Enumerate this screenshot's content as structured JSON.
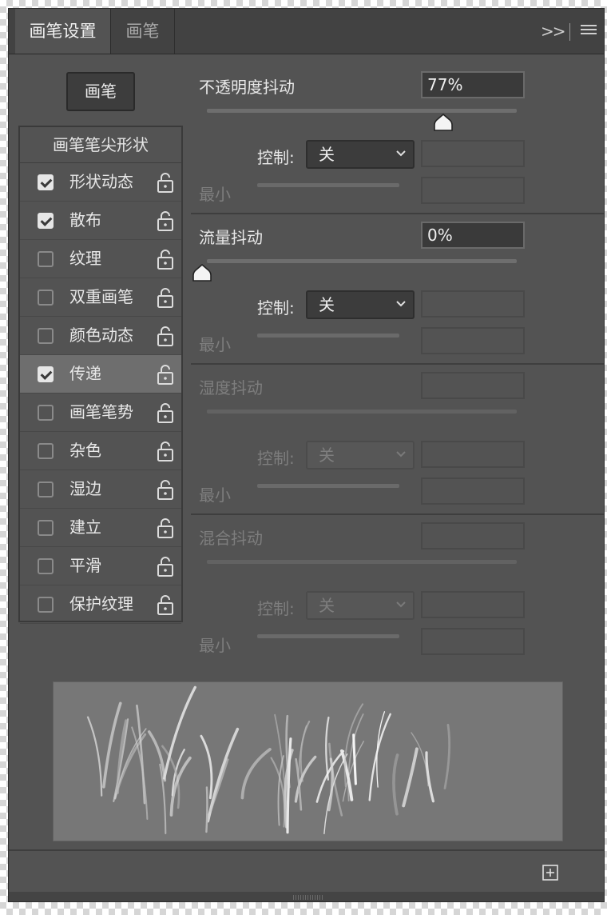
{
  "tabs": [
    {
      "label": "画笔设置",
      "active": true
    },
    {
      "label": "画笔",
      "active": false
    }
  ],
  "tab_icons": {
    "expand": "double-chevron-right-icon",
    "expand_glyph": ">>",
    "menu": "hamburger-menu-icon"
  },
  "brush_button": {
    "label": "画笔"
  },
  "list": {
    "header": "画笔笔尖形状",
    "items": [
      {
        "label": "形状动态",
        "checked": true,
        "selected": false
      },
      {
        "label": "散布",
        "checked": true,
        "selected": false
      },
      {
        "label": "纹理",
        "checked": false,
        "selected": false
      },
      {
        "label": "双重画笔",
        "checked": false,
        "selected": false
      },
      {
        "label": "颜色动态",
        "checked": false,
        "selected": false
      },
      {
        "label": "传递",
        "checked": true,
        "selected": true
      },
      {
        "label": "画笔笔势",
        "checked": false,
        "selected": false
      },
      {
        "label": "杂色",
        "checked": false,
        "selected": false
      },
      {
        "label": "湿边",
        "checked": false,
        "selected": false
      },
      {
        "label": "建立",
        "checked": false,
        "selected": false
      },
      {
        "label": "平滑",
        "checked": false,
        "selected": false
      },
      {
        "label": "保护纹理",
        "checked": false,
        "selected": false
      }
    ]
  },
  "sections": [
    {
      "label": "不透明度抖动",
      "value": "77%",
      "slider": 0.77,
      "enabled": true,
      "control_label": "控制:",
      "control_value": "关",
      "min_label": "最小"
    },
    {
      "label": "流量抖动",
      "value": "0%",
      "slider": 0.0,
      "enabled": true,
      "control_label": "控制:",
      "control_value": "关",
      "min_label": "最小"
    },
    {
      "label": "湿度抖动",
      "value": "",
      "enabled": false,
      "control_label": "控制:",
      "control_value": "关",
      "min_label": "最小"
    },
    {
      "label": "混合抖动",
      "value": "",
      "enabled": false,
      "control_label": "控制:",
      "control_value": "关",
      "min_label": "最小"
    }
  ],
  "icons": {
    "lock": "unlock-icon",
    "chevron": "chevron-down-icon",
    "new_preset": "create-new-brush-icon",
    "thumb": "slider-thumb-icon"
  },
  "colors": {
    "panel": "#535353",
    "tabbar": "#424242",
    "selected_row": "#6e6e6e"
  }
}
